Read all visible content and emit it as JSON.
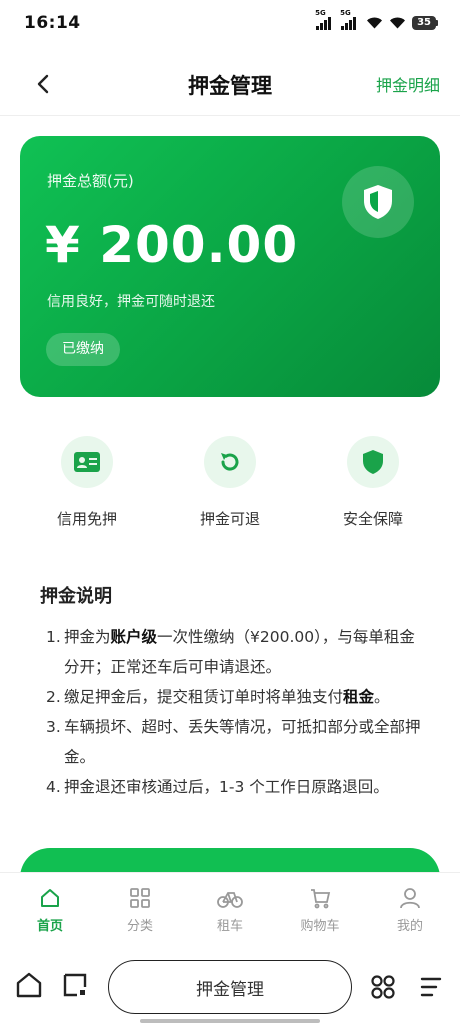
{
  "status_bar": {
    "time": "16:14",
    "signal1": "5G",
    "signal2": "5G",
    "battery": "35"
  },
  "nav": {
    "title": "押金管理",
    "right_link": "押金明细"
  },
  "card": {
    "label": "押金总额(元)",
    "amount": "¥ 200.00",
    "subtitle": "信用良好，押金可随时退还",
    "badge": "已缴纳"
  },
  "features": [
    {
      "label": "信用免押",
      "icon": "id-card-icon"
    },
    {
      "label": "押金可退",
      "icon": "refresh-icon"
    },
    {
      "label": "安全保障",
      "icon": "shield-icon"
    }
  ],
  "explanation": {
    "title": "押金说明",
    "items": [
      {
        "num": "1.",
        "pre": "押金为",
        "bold": "账户级",
        "post": "一次性缴纳（¥200.00），与每单租金分开；正常还车后可申请退还。"
      },
      {
        "num": "2.",
        "pre": "缴足押金后，提交租赁订单时将单独支付",
        "bold": "租金",
        "post": "。"
      },
      {
        "num": "3.",
        "pre": "车辆损坏、超时、丢失等情况，可抵扣部分或全部押金。",
        "bold": "",
        "post": ""
      },
      {
        "num": "4.",
        "pre": "押金退还审核通过后，1-3 个工作日原路退回。",
        "bold": "",
        "post": ""
      }
    ]
  },
  "tabbar": [
    {
      "label": "首页",
      "icon": "home-icon",
      "active": true
    },
    {
      "label": "分类",
      "icon": "grid-icon",
      "active": false
    },
    {
      "label": "租车",
      "icon": "bicycle-icon",
      "active": false
    },
    {
      "label": "购物车",
      "icon": "cart-icon",
      "active": false
    },
    {
      "label": "我的",
      "icon": "user-icon",
      "active": false
    }
  ],
  "system_nav": {
    "pill_label": "押金管理"
  },
  "colors": {
    "accent": "#1aa34a",
    "card_start": "#10c154",
    "card_end": "#078a39"
  }
}
